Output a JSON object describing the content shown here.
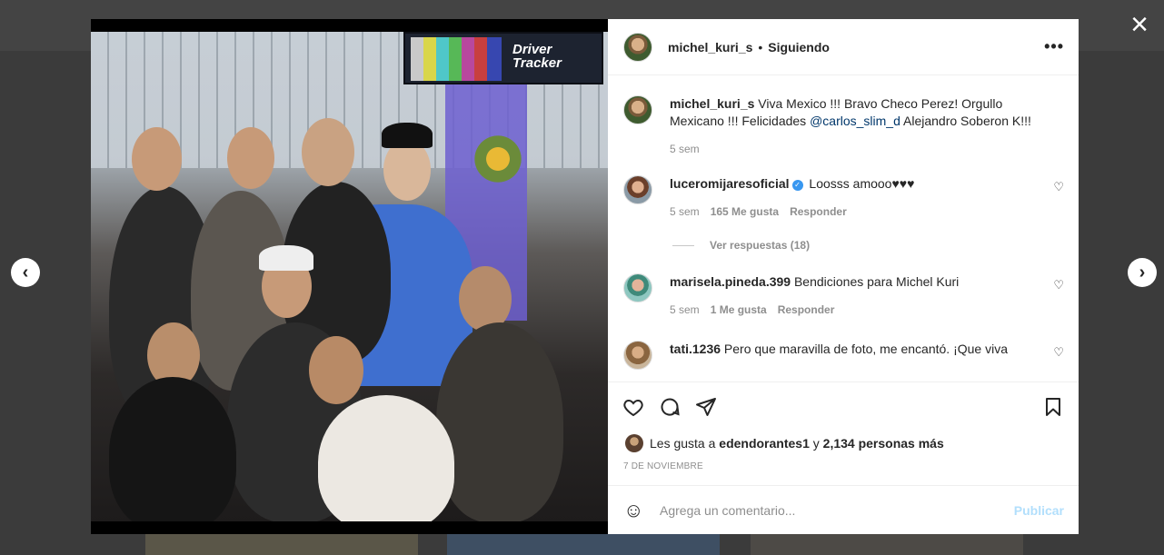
{
  "modal": {
    "close_icon": "close-icon",
    "prev_icon": "chevron-left-icon",
    "next_icon": "chevron-right-icon",
    "close_glyph": "×",
    "prev_glyph": "‹",
    "next_glyph": "›"
  },
  "photo": {
    "tv_text": "Driver Tracker"
  },
  "header": {
    "username": "michel_kuri_s",
    "separator": "•",
    "follow_status": "Siguiendo",
    "more_glyph": "•••"
  },
  "caption": {
    "username": "michel_kuri_s",
    "text_before": " Viva Mexico !!! Bravo Checo Perez! Orgullo Mexicano !!! Felicidades ",
    "mention": "@carlos_slim_d",
    "text_after": " Alejandro Soberon K!!!",
    "time": "5 sem"
  },
  "comments": [
    {
      "username": "luceromijaresoficial",
      "verified": true,
      "text": " Loosss amooo♥♥♥",
      "time": "5 sem",
      "likes": "165 Me gusta",
      "reply": "Responder",
      "view_replies": "Ver respuestas (18)"
    },
    {
      "username": "marisela.pineda.399",
      "text": " Bendiciones para Michel Kuri",
      "time": "5 sem",
      "likes": "1 Me gusta",
      "reply": "Responder"
    },
    {
      "username": "tati.1236",
      "text": " Pero que maravilla de foto, me encantó. ¡Que viva"
    }
  ],
  "likes": {
    "prefix": "Les gusta a ",
    "user": "edendorantes1",
    "middle": " y ",
    "count": "2,134 personas más"
  },
  "date": "7 DE NOVIEMBRE",
  "add_comment": {
    "placeholder": "Agrega un comentario...",
    "publish": "Publicar",
    "emoji_glyph": "☺"
  },
  "heart_glyph": "♡",
  "verified_glyph": "✓"
}
